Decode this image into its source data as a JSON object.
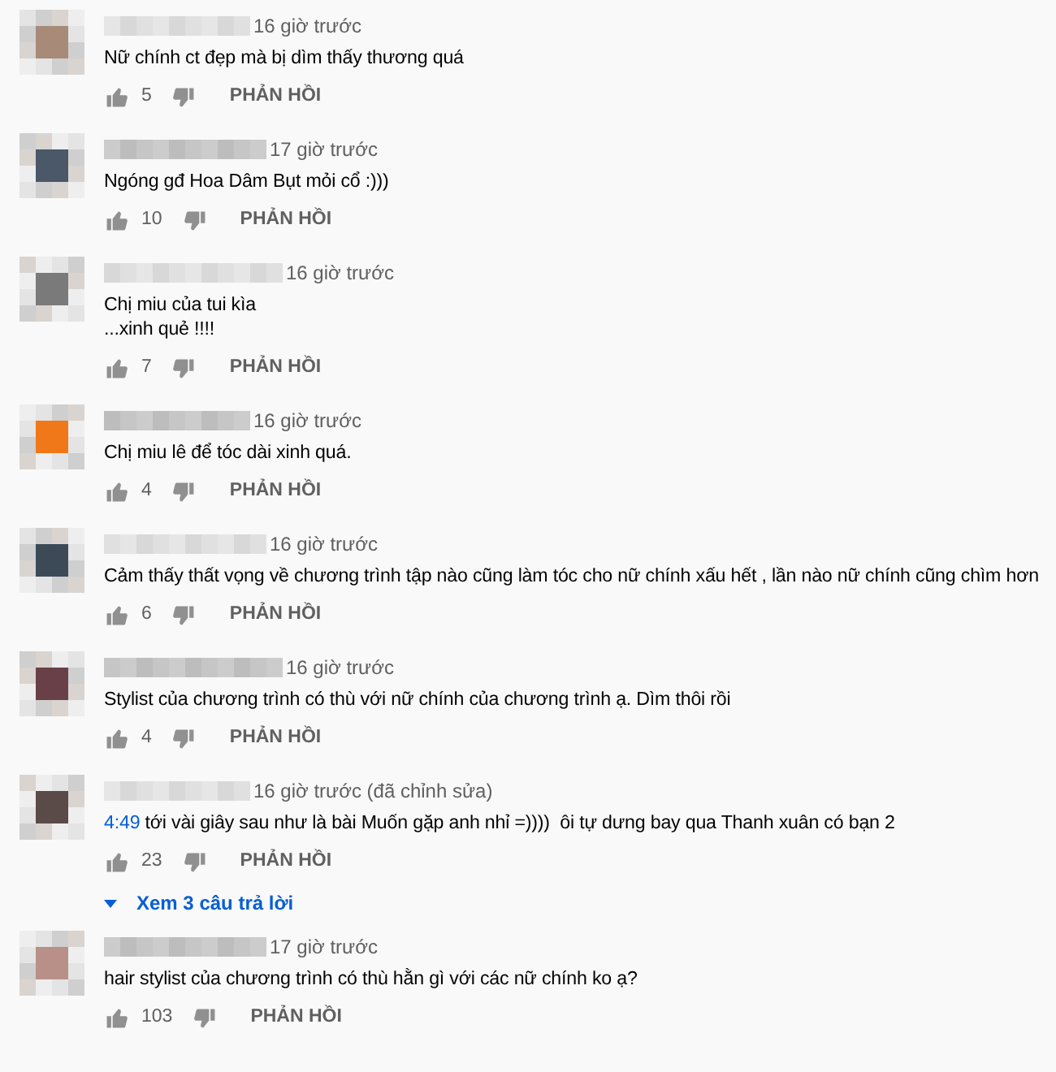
{
  "comments": [
    {
      "color": "#a88a78",
      "time": "16 giờ trước",
      "text": "Nữ chính ct đẹp mà bị dìm thấy thương quá",
      "likes": "5",
      "reply": "PHẢN HỒI"
    },
    {
      "color": "#4a5868",
      "time": "17 giờ trước",
      "text": "Ngóng gđ Hoa Dâm Bụt mỏi cổ :)))",
      "likes": "10",
      "reply": "PHẢN HỒI"
    },
    {
      "color": "#7a7a7a",
      "time": "16 giờ trước",
      "text": "Chị miu của tui kìa\n...xinh quẻ !!!!",
      "likes": "7",
      "reply": "PHẢN HỒI"
    },
    {
      "color": "#f07818",
      "time": "16 giờ trước",
      "text": "Chị miu lê để tóc dài xinh quá.",
      "likes": "4",
      "reply": "PHẢN HỒI"
    },
    {
      "color": "#3c4a58",
      "time": "16 giờ trước",
      "text": "Cảm thấy thất vọng về chương trình tập nào cũng làm tóc cho nữ chính xấu hết , lần nào nữ chính cũng chìm hơn",
      "likes": "6",
      "reply": "PHẢN HỒI"
    },
    {
      "color": "#6a4048",
      "time": "16 giờ trước",
      "text": "Stylist của chương trình có thù với nữ chính của chương trình ạ. Dìm thôi rồi",
      "likes": "4",
      "reply": "PHẢN HỒI"
    },
    {
      "color": "#5a4a48",
      "time": "16 giờ trước (đã chỉnh sửa)",
      "link": "4:49",
      "text": " tới vài giây sau như là bài Muốn gặp anh nhỉ =))))  ôi tự dưng bay qua Thanh xuân có bạn 2",
      "likes": "23",
      "reply": "PHẢN HỒI",
      "replies": "Xem 3 câu trả lời"
    },
    {
      "color": "#b89088",
      "time": "17 giờ trước",
      "text": "hair stylist của chương trình có thù hằn gì với các nữ chính ko ạ?",
      "likes": "103",
      "reply": "PHẢN HỒI"
    }
  ]
}
